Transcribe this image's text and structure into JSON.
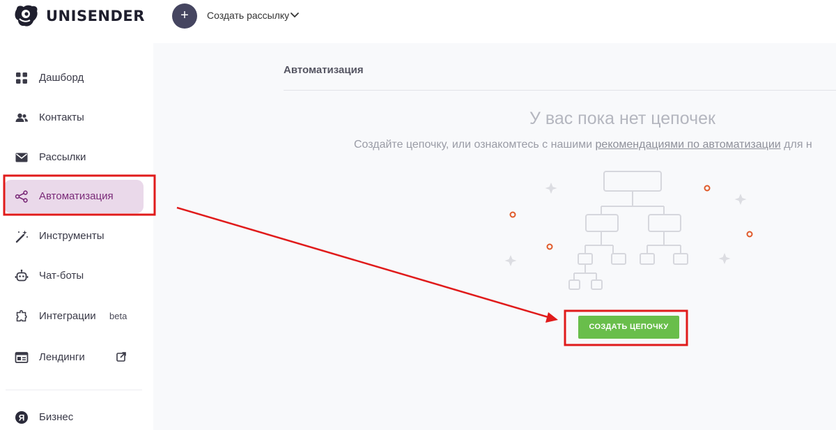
{
  "app": {
    "logo_text": "UNISENDER"
  },
  "topbar": {
    "create_label": "Создать рассылку",
    "plus_symbol": "+"
  },
  "sidebar": {
    "items": [
      {
        "label": "Дашборд",
        "icon": "dashboard-grid-icon"
      },
      {
        "label": "Контакты",
        "icon": "users-icon"
      },
      {
        "label": "Рассылки",
        "icon": "mail-icon"
      },
      {
        "label": "Автоматизация",
        "icon": "share-nodes-icon",
        "active": true
      },
      {
        "label": "Инструменты",
        "icon": "magic-wand-icon"
      },
      {
        "label": "Чат-боты",
        "icon": "robot-icon"
      },
      {
        "label": "Интеграции",
        "icon": "puzzle-icon",
        "badge": "beta"
      },
      {
        "label": "Лендинги",
        "icon": "landing-page-icon",
        "external": true
      },
      {
        "label": "Бизнес",
        "icon": "yandex-icon"
      }
    ]
  },
  "main": {
    "page_title": "Автоматизация",
    "empty_title": "У вас пока нет цепочек",
    "empty_text_before": "Создайте цепочку, или ознакомтесь с нашими ",
    "empty_text_link": "рекомендациями по автоматизации",
    "empty_text_after": " для н",
    "create_button": "СОЗДАТЬ ЦЕПОЧКУ"
  },
  "colors": {
    "accent_active": "#7a2a78",
    "active_bg": "#ead9ea",
    "button_green": "#69be4b",
    "annotation_red": "#e01b1b",
    "decor_orange": "#e05a2a"
  }
}
